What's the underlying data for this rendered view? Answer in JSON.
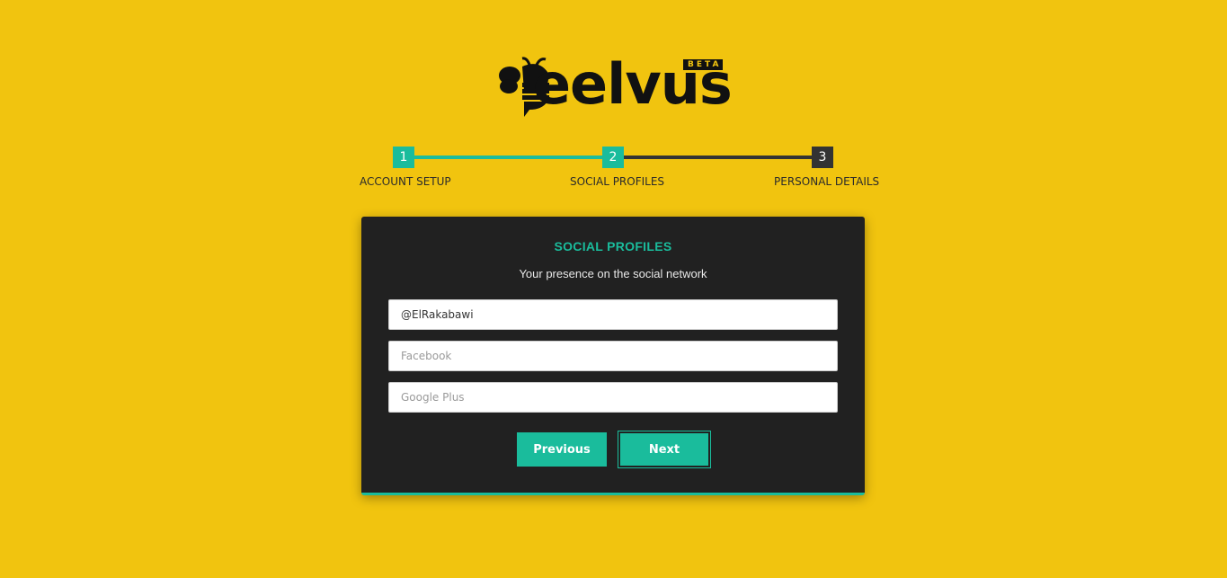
{
  "brand": {
    "name": "eelvus",
    "badge": "BETA"
  },
  "steps": [
    {
      "number": "1",
      "label": "ACCOUNT SETUP"
    },
    {
      "number": "2",
      "label": "SOCIAL PROFILES"
    },
    {
      "number": "3",
      "label": "PERSONAL DETAILS"
    }
  ],
  "colors": {
    "background": "#f1c40f",
    "accent": "#1abc9c",
    "card": "#212121",
    "inactive": "#333333"
  },
  "form": {
    "title": "SOCIAL PROFILES",
    "subtitle": "Your presence on the social network",
    "twitter": {
      "value": "@ElRakabawi",
      "placeholder": ""
    },
    "facebook": {
      "value": "",
      "placeholder": "Facebook"
    },
    "google_plus": {
      "value": "",
      "placeholder": "Google Plus"
    },
    "previous_label": "Previous",
    "next_label": "Next"
  }
}
